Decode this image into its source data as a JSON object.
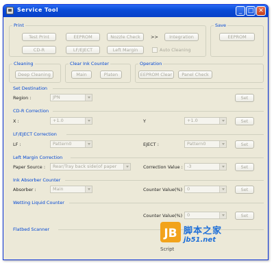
{
  "window": {
    "title": "Service Tool"
  },
  "print": {
    "title": "Print",
    "buttons": [
      "Test Print",
      "EEPROM",
      "Nozzle Check",
      "Integration",
      "CD-R",
      "LF/EJECT",
      "Left Margin"
    ],
    "arrows": ">>",
    "auto_cleaning": "Auto Cleaning"
  },
  "save": {
    "title": "Save",
    "eeprom": "EEPROM"
  },
  "cleaning": {
    "title": "Cleaning",
    "deep": "Deep Cleaning"
  },
  "clear_ink": {
    "title": "Clear Ink Counter",
    "main": "Main",
    "platen": "Platen"
  },
  "operation": {
    "title": "Operation",
    "eeprom_clear": "EEPROM Clear",
    "panel_check": "Panel Check"
  },
  "destination": {
    "title": "Set Destination",
    "region_label": "Region :",
    "region_value": "JPN",
    "set": "Set"
  },
  "cdr": {
    "title": "CD-R Correction",
    "x_label": "X :",
    "x_value": "+1.0",
    "y_label": "Y",
    "y_value": "+1.0",
    "set": "Set"
  },
  "lf_eject": {
    "title": "LF/EJECT Correction",
    "lf_label": "LF :",
    "lf_value": "Pattern0",
    "eject_label": "EJECT :",
    "eject_value": "Pattern0",
    "set": "Set"
  },
  "left_margin": {
    "title": "Left Margin Correction",
    "source_label": "Paper Source :",
    "source_value": "Rear/Tray back side(of paper",
    "value_label": "Correction Value :",
    "value": "-3",
    "set": "Set"
  },
  "ink_absorber": {
    "title": "Ink Absorber Counter",
    "absorber_label": "Absorber :",
    "absorber_value": "Main",
    "counter_label": "Counter Value(%) :",
    "counter_value": "0",
    "set": "Set"
  },
  "wetting": {
    "title": "Wetting Liquid Counter",
    "counter_label": "Counter Value(%) :",
    "counter_value": "0",
    "set": "Set"
  },
  "flatbed": {
    "title": "Flatbed Scanner"
  },
  "watermark": {
    "cn": "脚本之家",
    "url": "jb51.net",
    "script": "Script",
    "logo": "JB"
  }
}
